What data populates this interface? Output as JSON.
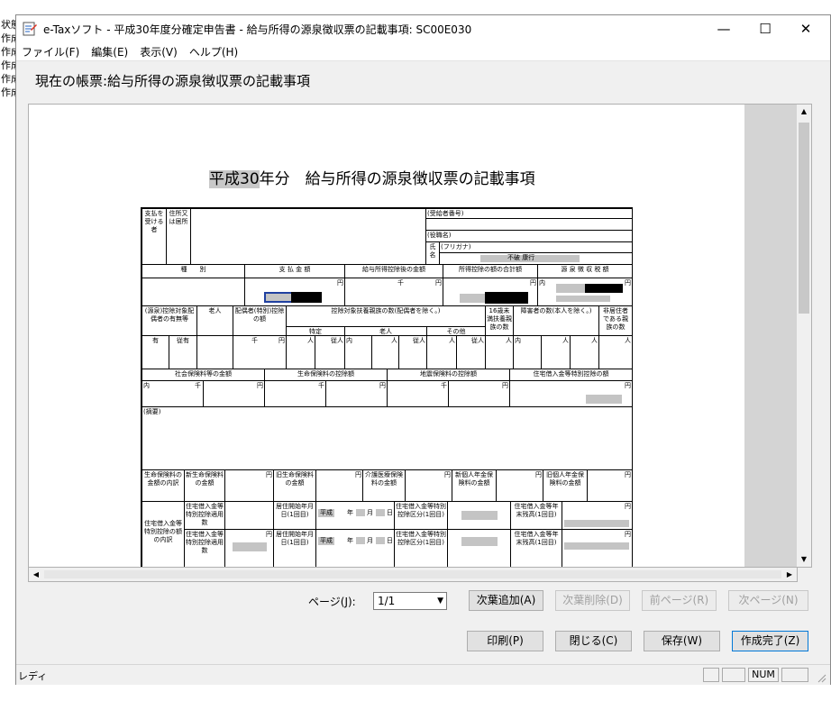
{
  "background_window": {
    "lines": [
      "状態",
      "作成",
      "作成",
      "作成",
      "作成",
      "作成"
    ]
  },
  "window": {
    "title": "e-Taxソフト - 平成30年度分確定申告書 - 給与所得の源泉徴収票の記載事項: SC00E030",
    "controls": {
      "minimize": "—",
      "maximize": "☐",
      "close": "✕"
    }
  },
  "menu": [
    {
      "label": "ファイル(F)"
    },
    {
      "label": "編集(E)"
    },
    {
      "label": "表示(V)"
    },
    {
      "label": "ヘルプ(H)"
    }
  ],
  "caption": "現在の帳票:給与所得の源泉徴収票の記載事項",
  "document": {
    "era_text": "平成30",
    "title_rest": "年分　給与所得の源泉徴収票の記載事項",
    "form": {
      "payee_label": "支払を受ける者",
      "address_label": "住所又は居所",
      "recipient_no": "(受給者番号)",
      "position_label": "(役職名)",
      "name_label": "氏名",
      "furigana_label": "(フリガナ)",
      "furigana_value": "不破 康行",
      "type_label": "種　　別",
      "payment_label": "支 払 金 額",
      "after_deduction": "給与所得控除後の金額",
      "total_deduction": "所得控除の額の合計額",
      "withholding": "源 泉 徴 収 税 額",
      "unit_sen": "千",
      "unit_en": "円",
      "uchi": "内",
      "spouse_label": "(源泉)控除対象配偶者の有無等",
      "old_label": "老人",
      "spouse_special": "配偶者(特別)控除の額",
      "dependents_label": "控除対象扶養親族の数(配偶者を除く。)",
      "specific": "特定",
      "elderly": "老人",
      "other": "その他",
      "under16": "16歳未満扶養親族の数",
      "disabled": "障害者の数(本人を除く。)",
      "nonresident": "非居住者である親族の数",
      "ari": "有",
      "juu": "従有",
      "person": "人",
      "juunin": "従人",
      "social_ins": "社会保険料等の金額",
      "life_ins": "生命保険料の控除額",
      "quake_ins": "地震保険料の控除額",
      "housing_loan": "住宅借入金等特別控除の額",
      "remarks": "(摘要)",
      "life_breakdown": "生命保険料の金額の内訳",
      "new_life": "新生命保険料の金額",
      "old_life": "旧生命保険料の金額",
      "care_med": "介護医療保険料の金額",
      "new_pension": "新個人年金保険料の金額",
      "old_pension": "旧個人年金保険料の金額",
      "housing_breakdown": "住宅借入金等特別控除の額の内訳",
      "housing_applicable": "住宅借入金等特別控除適用数",
      "residence_start": "居住開始年月日(1回目)",
      "era_heisei": "平成",
      "year": "年",
      "month": "月",
      "day": "日",
      "deduction_type": "住宅借入金等特別控除区分(1回目)",
      "loan_balance": "住宅借入金等年末残高(1回目)"
    }
  },
  "pager": {
    "label": "ページ(J):",
    "value": "1/1",
    "add_label": "次葉追加(A)",
    "delete_label": "次葉削除(D)",
    "prev_label": "前ページ(R)",
    "next_label": "次ページ(N)"
  },
  "actions": {
    "print": "印刷(P)",
    "close": "閉じる(C)",
    "save": "保存(W)",
    "complete": "作成完了(Z)"
  },
  "status": {
    "text": "レディ",
    "num": "NUM"
  }
}
